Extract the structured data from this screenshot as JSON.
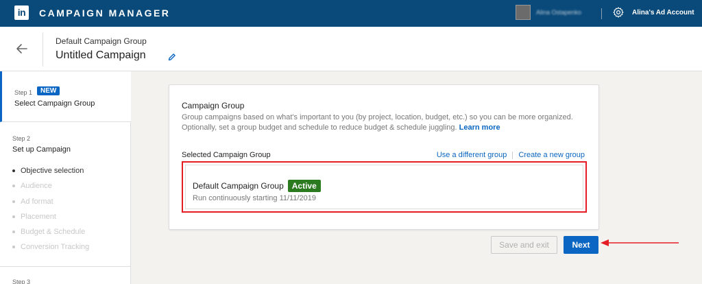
{
  "topbar": {
    "logo_text": "in",
    "app_name": "CAMPAIGN MANAGER",
    "user_name": "Alina Ostapenko",
    "account_name": "Alina's Ad Account"
  },
  "header": {
    "group_name": "Default Campaign Group",
    "campaign_name": "Untitled Campaign"
  },
  "sidebar": {
    "step1": {
      "label": "Step 1",
      "badge": "NEW",
      "title": "Select Campaign Group"
    },
    "step2": {
      "label": "Step 2",
      "title": "Set up Campaign",
      "items": [
        {
          "label": "Objective selection"
        },
        {
          "label": "Audience"
        },
        {
          "label": "Ad format"
        },
        {
          "label": "Placement"
        },
        {
          "label": "Budget & Schedule"
        },
        {
          "label": "Conversion Tracking"
        }
      ]
    },
    "step3": {
      "label": "Step 3"
    }
  },
  "card": {
    "title": "Campaign Group",
    "description": "Group campaigns based on what's important to you (by project, location, budget, etc.) so you can be more organized. Optionally, set a group budget and schedule to reduce budget & schedule juggling.",
    "learn_more": "Learn more",
    "selected_label": "Selected Campaign Group",
    "use_different": "Use a different group",
    "create_new": "Create a new group",
    "selected_group": {
      "name": "Default Campaign Group",
      "status": "Active",
      "schedule": "Run continuously starting 11/11/2019"
    }
  },
  "actions": {
    "save_exit": "Save and exit",
    "next": "Next"
  },
  "colors": {
    "topbar": "#0a4a7a",
    "primary": "#0a66c2",
    "active_badge": "#2c7a1f",
    "highlight": "#e51c23"
  }
}
